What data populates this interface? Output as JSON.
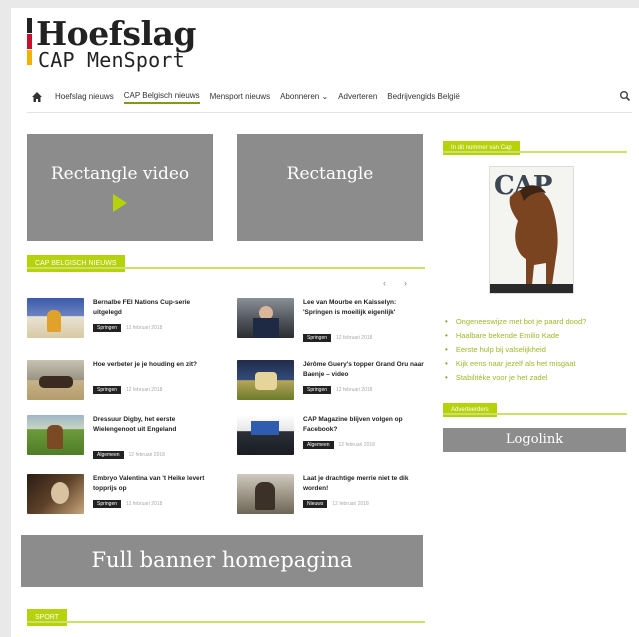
{
  "brand": {
    "title": "Hoefslag",
    "subtitle": "CAP MenSport",
    "stripe_colors": [
      "#222222",
      "#c8102e",
      "#f2b300"
    ]
  },
  "colors": {
    "accent": "#b6d20a",
    "accent_rule": "#cfe068",
    "placeholder": "#8c8c8c"
  },
  "nav": {
    "home_icon": "home-icon",
    "search_icon": "search-icon",
    "items": [
      {
        "label": "Hoefslag nieuws",
        "active": false
      },
      {
        "label": "CAP Belgisch nieuws",
        "active": true
      },
      {
        "label": "Mensport nieuws",
        "active": false
      },
      {
        "label": "Abonneren ⌄",
        "active": false
      },
      {
        "label": "Adverteren",
        "active": false
      },
      {
        "label": "Bedrijvengids België",
        "active": false
      }
    ]
  },
  "placeholders": {
    "video": "Rectangle video",
    "rectangle": "Rectangle",
    "banner": "Full banner homepagina",
    "logolink": "Logolink"
  },
  "sections": {
    "nieuws": "CAP BELGISCH NIEUWS",
    "sport": "SPORT",
    "cap_issue": "In dit nummer van Cap",
    "adverteerders": "Adverteerders"
  },
  "carousel_arrows": [
    "‹",
    "›"
  ],
  "news": [
    {
      "title": "Bernalbe FEI Nations Cup-serie uitgelegd",
      "category": "Springen",
      "date": "12 februari 2018"
    },
    {
      "title": "Lee van Mourbe en Kaisselyn: 'Springen is moeilijk eigenlijk'",
      "category": "Springen",
      "date": "12 februari 2018"
    },
    {
      "title": "Hoe verbeter je je houding en zit?",
      "category": "Springen",
      "date": "12 februari 2018"
    },
    {
      "title": "Jérôme Guery's topper Grand Oru naar Baenje – video",
      "category": "Springen",
      "date": "12 februari 2018"
    },
    {
      "title": "Dressuur Digby, het eerste Wielengenoot uit Engeland",
      "category": "Algemeen",
      "date": "12 februari 2018"
    },
    {
      "title": "CAP Magazine blijven volgen op Facebook?",
      "category": "Algemeen",
      "date": "12 februari 2018"
    },
    {
      "title": "Embryo Valentina van 't Heike levert topprijs op",
      "category": "Springen",
      "date": "12 februari 2018"
    },
    {
      "title": "Laat je drachtige merrie niet te dik worden!",
      "category": "Nieuws",
      "date": "12 februari 2018"
    }
  ],
  "cap_cover": {
    "logo": "CAP"
  },
  "issue_links": [
    "Ongeneeswijze met bot je paard dood?",
    "Haalbare bekende Emilio Kade",
    "Eerste hulp bij valselijkheid",
    "Kijk eens naar jezelf als het misgaat",
    "Stabilitéke voor je het zadel"
  ]
}
